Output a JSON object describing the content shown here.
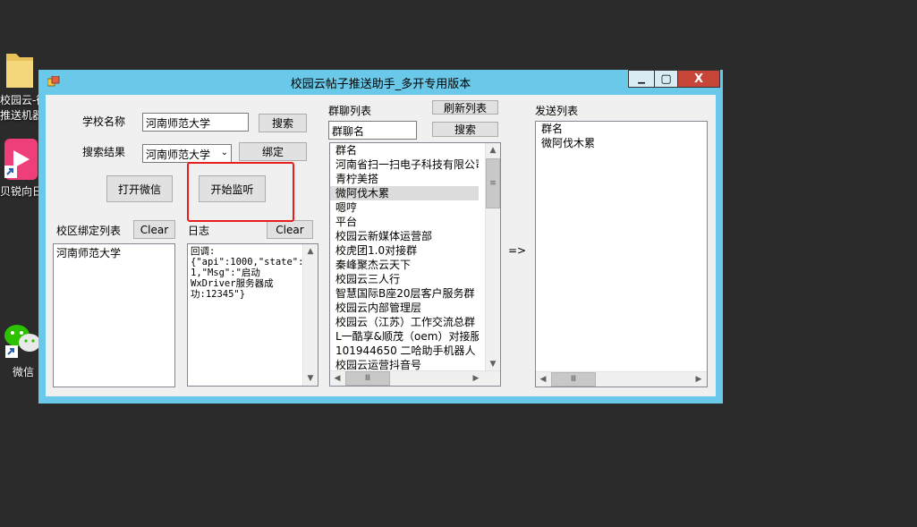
{
  "desktop": {
    "folder_label_line1": "校园云-微",
    "folder_label_line2": "推送机器",
    "app_label": "贝锐向日",
    "wechat_label": "微信"
  },
  "window": {
    "title": "校园云帖子推送助手_多开专用版本",
    "minimize_glyph": "▁",
    "maximize_glyph": "▢",
    "close_glyph": "X"
  },
  "form": {
    "school_name_label": "学校名称",
    "school_name_value": "河南师范大学",
    "search_button": "搜索",
    "search_result_label": "搜索结果",
    "search_result_value": "河南师范大学",
    "bind_button": "绑定",
    "open_wechat_button": "打开微信",
    "start_listen_button": "开始监听"
  },
  "campus_bind": {
    "label": "校区绑定列表",
    "clear_button": "Clear",
    "items": [
      "河南师范大学"
    ]
  },
  "log": {
    "label": "日志",
    "clear_button": "Clear",
    "lines": [
      "回调:",
      "{\"api\":1000,\"state\":",
      "1,\"Msg\":\"启动",
      "WxDriver服务器成",
      "功:12345\"}"
    ]
  },
  "group_chat": {
    "label": "群聊列表",
    "refresh_button": "刷新列表",
    "search_value": "群聊名",
    "search_button": "搜索",
    "header": "群名",
    "rows": [
      "河南省扫一扫电子科技有限公司",
      "青柠美搭",
      "微阿伐木累",
      "嗯哼",
      "平台",
      "校园云新媒体运营部",
      "校虎团1.0对接群",
      "秦峰聚杰云天下",
      "校园云三人行",
      "智慧国际B座20层客户服务群",
      "校园云内部管理层",
      "校园云（江苏）工作交流总群",
      "L一酷享&顺茂（oem）对接服务群",
      "101944650 二哈助手机器人",
      "校园云运营抖音号"
    ],
    "selected_index": 2
  },
  "arrow_text": "=>",
  "send_list": {
    "label": "发送列表",
    "header": "群名",
    "rows": [
      "微阿伐木累"
    ]
  },
  "scroll": {
    "up": "▲",
    "down": "▼",
    "left": "◀",
    "right": "▶",
    "grip": "Ⅲ",
    "vgrip": "≡"
  }
}
